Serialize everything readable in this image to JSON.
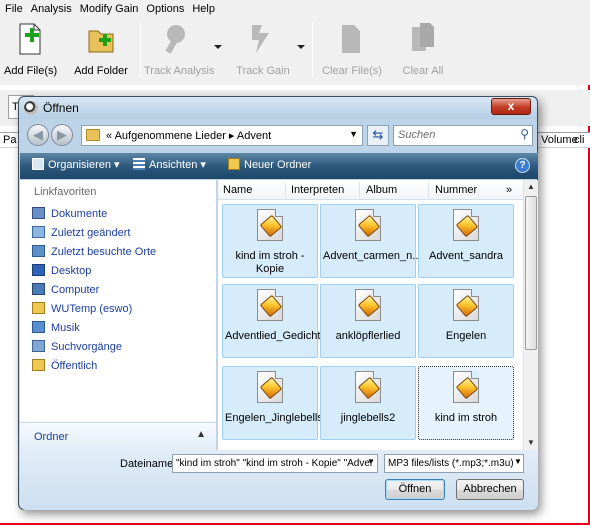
{
  "app": {
    "menu": [
      "File",
      "Analysis",
      "Modify Gain",
      "Options",
      "Help"
    ],
    "toolbar": {
      "add_files": "Add File(s)",
      "add_folder": "Add Folder",
      "track_analysis": "Track Analysis",
      "track_gain": "Track Gain",
      "clear_files": "Clear File(s)",
      "clear_all": "Clear All"
    },
    "path_prefix": "T",
    "columns": [
      "Pa",
      "Volume",
      "cli"
    ]
  },
  "dialog": {
    "title": "Öffnen",
    "close_label": "x",
    "address_path": "«  Aufgenommene Lieder  ▸  Advent",
    "search_placeholder": "Suchen",
    "commands": {
      "organize": "Organisieren",
      "views": "Ansichten",
      "new_folder": "Neuer Ordner"
    },
    "favorites_heading": "Linkfavoriten",
    "favorites": [
      {
        "label": "Dokumente",
        "icon": "documents-icon"
      },
      {
        "label": "Zuletzt geändert",
        "icon": "recent-changed-icon"
      },
      {
        "label": "Zuletzt besuchte Orte",
        "icon": "recent-places-icon"
      },
      {
        "label": "Desktop",
        "icon": "desktop-icon"
      },
      {
        "label": "Computer",
        "icon": "computer-icon"
      },
      {
        "label": "WUTemp (eswo)",
        "icon": "network-folder-icon"
      },
      {
        "label": "Musik",
        "icon": "music-icon"
      },
      {
        "label": "Suchvorgänge",
        "icon": "searches-icon"
      },
      {
        "label": "Öffentlich",
        "icon": "public-folder-icon"
      }
    ],
    "folder_pane_label": "Ordner",
    "file_columns": [
      "Name",
      "Interpreten",
      "Album",
      "Nummer",
      "»"
    ],
    "files": [
      "kind im stroh - Kopie",
      "Advent_carmen_n...",
      "Advent_sandra",
      "Adventlied_Gedicht",
      "anklöpflerlied",
      "Engelen",
      "Engelen_Jinglebells",
      "jinglebells2",
      "kind im stroh"
    ],
    "filename_label": "Dateiname:",
    "filename_value": "\"kind im stroh\" \"kind im stroh - Kopie\" \"Adver",
    "filetype_value": "MP3 files/lists (*.mp3;*.m3u)",
    "open_button": "Öffnen",
    "cancel_button": "Abbrechen"
  },
  "colors": {
    "accent_red": "#e0001b",
    "command_bar": "#2e5a7e",
    "link_blue": "#1c3fa0",
    "tile_selected": "#d7ecfa"
  }
}
